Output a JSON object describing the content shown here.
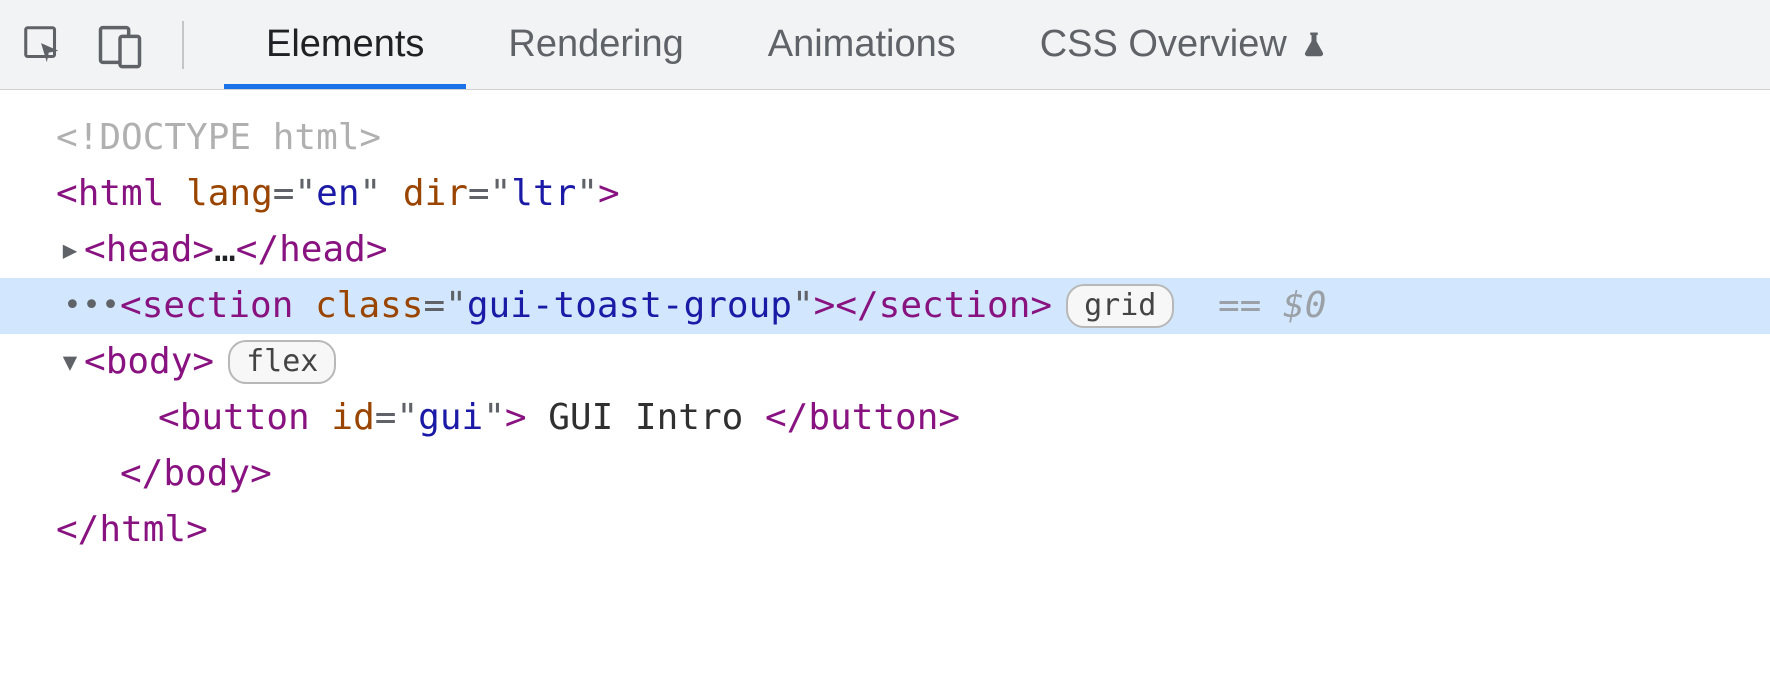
{
  "tabs": {
    "elements": "Elements",
    "rendering": "Rendering",
    "animations": "Animations",
    "css_overview": "CSS Overview"
  },
  "dom": {
    "doctype": "<!DOCTYPE html>",
    "html_tag": "html",
    "html_attr_lang_name": "lang",
    "html_attr_lang_val": "en",
    "html_attr_dir_name": "dir",
    "html_attr_dir_val": "ltr",
    "head_tag": "head",
    "head_ellipsis": "…",
    "section_tag": "section",
    "section_attr_class_name": "class",
    "section_attr_class_val": "gui-toast-group",
    "section_badge": "grid",
    "selection_tail": "== $0",
    "body_tag": "body",
    "body_badge": "flex",
    "button_tag": "button",
    "button_attr_id_name": "id",
    "button_attr_id_val": "gui",
    "button_text": " GUI Intro ",
    "gutter_ellipsis": "•••"
  }
}
